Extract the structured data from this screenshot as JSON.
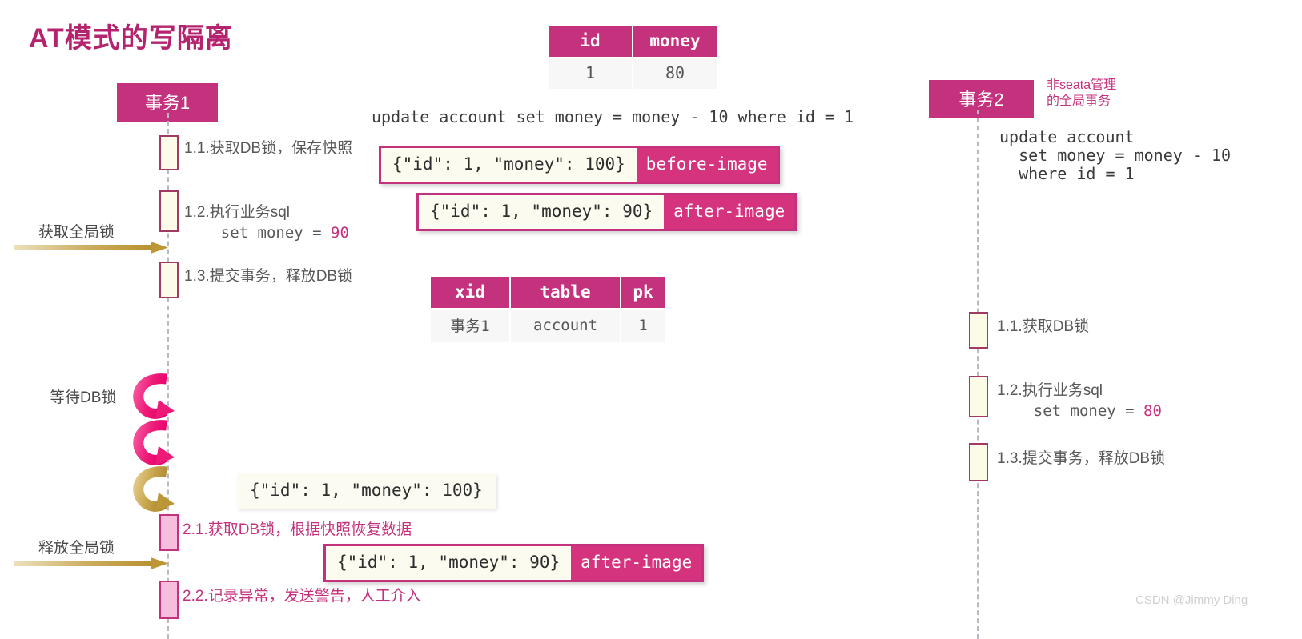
{
  "title": "AT模式的写隔离",
  "watermark": "CSDN @Jimmy Ding",
  "colors": {
    "brand_pink": "#c4317c",
    "tag_pink": "#d6337f",
    "title_pink": "#b5236f",
    "activation_fill": "#fcfbe8",
    "activation_fill_pink": "#f6bedd",
    "gold": "#c3a04a",
    "hot_pink": "#ed1e79",
    "lifeline_gray": "#b9b9c4"
  },
  "account_table": {
    "headers": [
      "id",
      "money"
    ],
    "rows": [
      [
        "1",
        "80"
      ]
    ]
  },
  "lock_table": {
    "headers": [
      "xid",
      "table",
      "pk"
    ],
    "rows": [
      [
        "事务1",
        "account",
        "1"
      ]
    ]
  },
  "tx1": {
    "header": "事务1",
    "sql": "update account set money = money - 10 where id = 1",
    "steps": [
      {
        "id": "1.1",
        "text": "1.1.获取DB锁，保存快照"
      },
      {
        "id": "1.2",
        "text": "1.2.执行业务sql"
      },
      {
        "id": "1.2b",
        "text": "    set money = 90",
        "value": "90"
      },
      {
        "id": "1.3",
        "text": "1.3.提交事务，释放DB锁"
      },
      {
        "id": "2.1",
        "text": "2.1.获取DB锁，根据快照恢复数据"
      },
      {
        "id": "2.2",
        "text": "2.2.记录异常，发送警告，人工介入"
      }
    ],
    "labels": {
      "acquire_global_lock": "获取全局锁",
      "wait_db_lock": "等待DB锁",
      "release_global_lock": "释放全局锁"
    }
  },
  "tx2": {
    "header": "事务2",
    "note": "非seata管理\n的全局事务",
    "sql": "update account\n  set money = money - 10\n  where id = 1",
    "steps": [
      {
        "id": "1.1",
        "text": "1.1.获取DB锁"
      },
      {
        "id": "1.2",
        "text": "1.2.执行业务sql"
      },
      {
        "id": "1.2b",
        "text": "    set money = 80",
        "value": "80"
      },
      {
        "id": "1.3",
        "text": "1.3.提交事务，释放DB锁"
      }
    ]
  },
  "images": {
    "before": {
      "json": "{\"id\": 1, \"money\": 100}",
      "tag": "before-image"
    },
    "after": {
      "json": "{\"id\": 1, \"money\": 90}",
      "tag": "after-image"
    },
    "after2": {
      "json": "{\"id\": 1, \"money\": 90}",
      "tag": "after-image"
    },
    "snapshot": {
      "json": "{\"id\": 1, \"money\": 100}"
    }
  }
}
